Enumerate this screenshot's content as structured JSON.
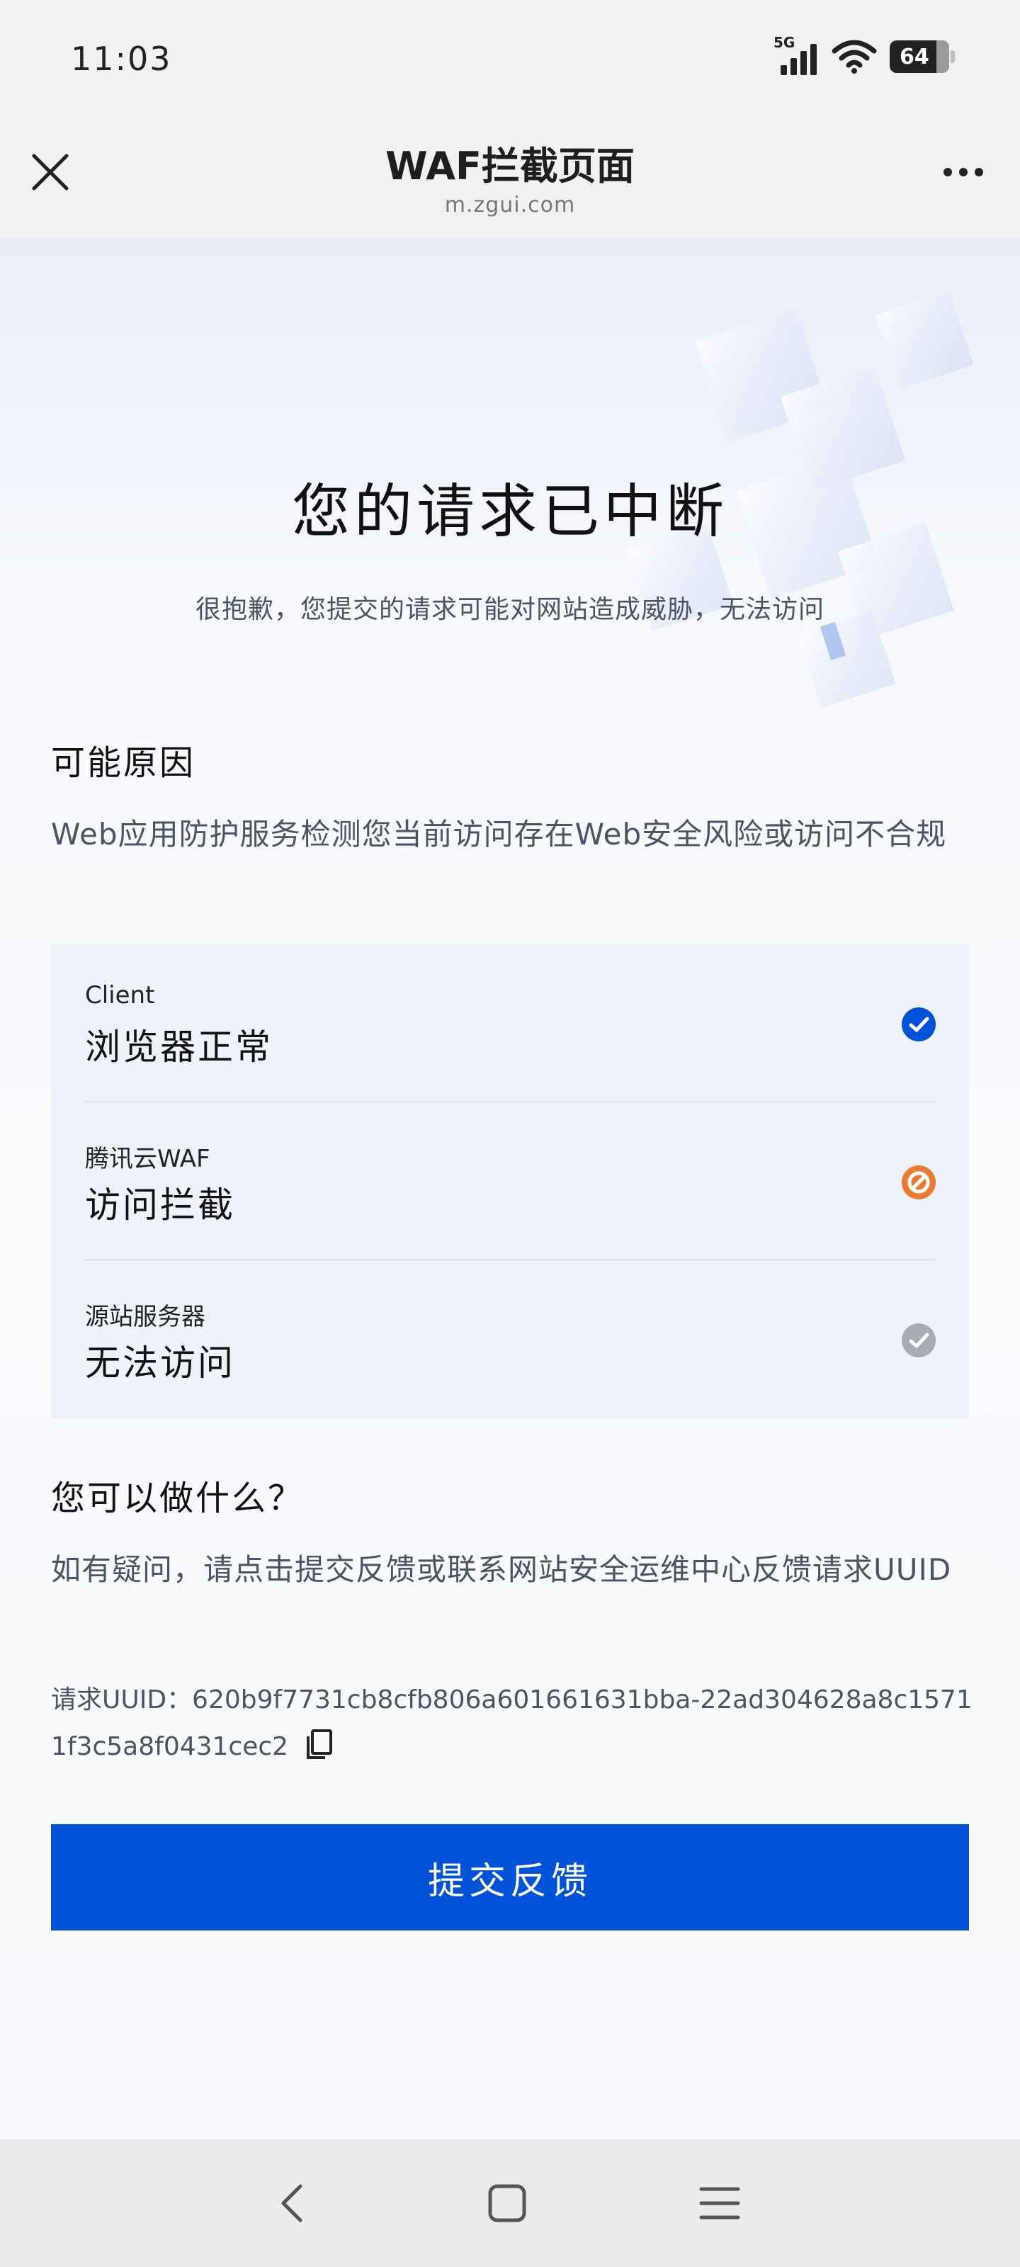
{
  "status_bar": {
    "time": "11:03",
    "network_label": "5G",
    "battery_level": "64",
    "icons": [
      "signal-icon",
      "wifi-icon",
      "battery-icon"
    ]
  },
  "header": {
    "title": "WAF拦截页面",
    "url": "m.zgui.com",
    "icons": {
      "close": "close-icon",
      "more": "more-icon"
    }
  },
  "main": {
    "title": "您的请求已中断",
    "subtitle": "很抱歉，您提交的请求可能对网站造成威胁，无法访问"
  },
  "reason": {
    "heading": "可能原因",
    "text": "Web应用防护服务检测您当前访问存在Web安全风险或访问不合规"
  },
  "status_items": [
    {
      "label": "Client",
      "value": "浏览器正常",
      "status": "ok",
      "icon": "check-circle-icon",
      "color": "#0052d9"
    },
    {
      "label": "腾讯云WAF",
      "value": "访问拦截",
      "status": "blocked",
      "icon": "blocked-icon",
      "color": "#ed7b2f"
    },
    {
      "label": "源站服务器",
      "value": "无法访问",
      "status": "unreachable",
      "icon": "check-circle-gray-icon",
      "color": "#a6abb5"
    }
  ],
  "actions": {
    "heading": "您可以做什么？",
    "text": "如有疑问，请点击提交反馈或联系网站安全运维中心反馈请求UUID",
    "uuid_label": "请求UUID：",
    "uuid": "620b9f7731cb8cfb806a601661631bba-22ad304628a8c15711f3c5a8f0431cec2",
    "copy_icon": "copy-icon",
    "button_label": "提交反馈"
  },
  "nav_bar": {
    "icons": [
      "back-icon",
      "home-icon",
      "menu-icon"
    ]
  },
  "colors": {
    "primary": "#0052d9",
    "warning": "#ed7b2f",
    "muted": "#a6abb5",
    "panel": "#eef2fb"
  }
}
